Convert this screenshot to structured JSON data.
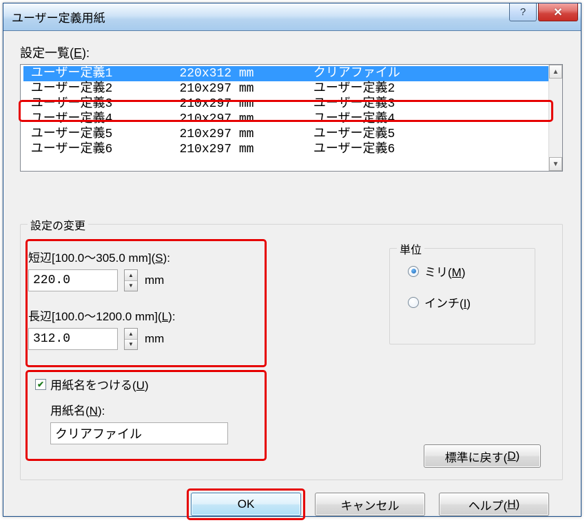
{
  "window": {
    "title": "ユーザー定義用紙"
  },
  "list": {
    "label": "設定一覧",
    "accel": "E",
    "rows": [
      {
        "name": "ユーザー定義1",
        "dim": "220x312 mm",
        "desc": "クリアファイル",
        "selected": true
      },
      {
        "name": "ユーザー定義2",
        "dim": "210x297 mm",
        "desc": "ユーザー定義2",
        "selected": false
      },
      {
        "name": "ユーザー定義3",
        "dim": "210x297 mm",
        "desc": "ユーザー定義3",
        "selected": false
      },
      {
        "name": "ユーザー定義4",
        "dim": "210x297 mm",
        "desc": "ユーザー定義4",
        "selected": false
      },
      {
        "name": "ユーザー定義5",
        "dim": "210x297 mm",
        "desc": "ユーザー定義5",
        "selected": false
      },
      {
        "name": "ユーザー定義6",
        "dim": "210x297 mm",
        "desc": "ユーザー定義6",
        "selected": false
      }
    ]
  },
  "change": {
    "legend": "設定の変更",
    "short": {
      "label_prefix": "短辺[100.0～305.0 mm](",
      "accel": "S",
      "label_suffix": "):",
      "value": "220.0",
      "unit": "mm"
    },
    "long": {
      "label_prefix": "長辺[100.0～1200.0 mm](",
      "accel": "L",
      "label_suffix": "):",
      "value": "312.0",
      "unit": "mm"
    },
    "papername": {
      "cb_prefix": "用紙名をつける(",
      "cb_accel": "U",
      "cb_suffix": ")",
      "checked": true,
      "lbl_prefix": "用紙名(",
      "lbl_accel": "N",
      "lbl_suffix": "):",
      "value": "クリアファイル"
    }
  },
  "unit": {
    "legend": "単位",
    "mm": {
      "prefix": "ミリ(",
      "accel": "M",
      "suffix": ")",
      "selected": true
    },
    "in": {
      "prefix": "インチ(",
      "accel": "I",
      "suffix": ")",
      "selected": false
    }
  },
  "buttons": {
    "reset_prefix": "標準に戻す(",
    "reset_accel": "D",
    "reset_suffix": ")",
    "ok": "OK",
    "cancel": "キャンセル",
    "help_prefix": "ヘルプ(",
    "help_accel": "H",
    "help_suffix": ")"
  },
  "titlebar": {
    "help_glyph": "?",
    "close_glyph": "✕"
  }
}
